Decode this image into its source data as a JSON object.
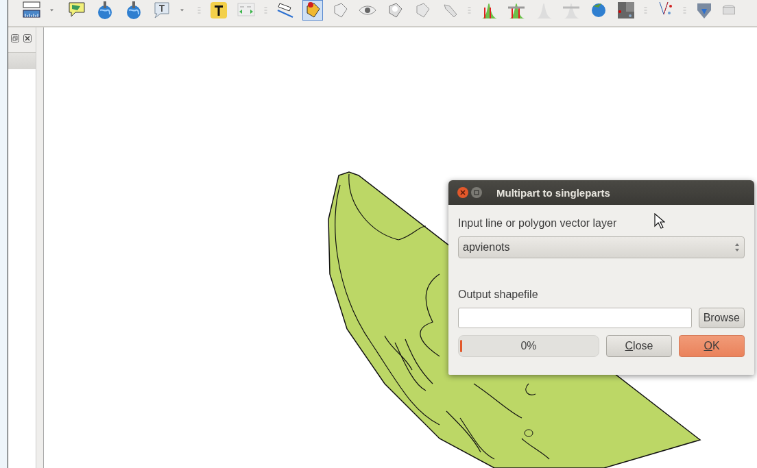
{
  "dialog": {
    "title": "Multipart to singleparts",
    "input_label": "Input line or polygon vector layer",
    "input_layer": {
      "value": "apvienots"
    },
    "output_label": "Output shapefile",
    "browse_button": "Browse",
    "progress": {
      "level": 0.01,
      "reading": "0%"
    },
    "buttons": [
      {
        "label": "Close",
        "kind": "default"
      },
      {
        "label": "OK",
        "kind": "primary"
      }
    ]
  }
}
